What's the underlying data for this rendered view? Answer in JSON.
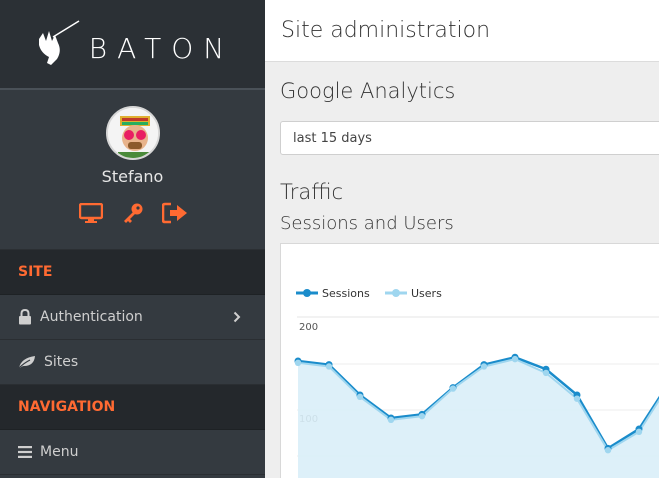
{
  "brand": {
    "name": "BATON"
  },
  "user": {
    "name": "Stefano"
  },
  "profile_actions": [
    {
      "name": "view-site",
      "icon": "monitor-icon"
    },
    {
      "name": "change-password",
      "icon": "key-icon"
    },
    {
      "name": "logout",
      "icon": "sign-out-icon"
    }
  ],
  "sidebar": {
    "site_title": "SITE",
    "site_items": [
      {
        "label": "Authentication",
        "icon": "lock-icon",
        "has_children": true
      },
      {
        "label": "Sites",
        "icon": "leaf-icon",
        "has_children": false
      }
    ],
    "nav_title": "NAVIGATION",
    "nav_items": [
      {
        "label": "Menu",
        "icon": "bars-icon"
      }
    ]
  },
  "header": {
    "title": "Site administration"
  },
  "analytics": {
    "title": "Google Analytics",
    "period_select": {
      "value": "last 15 days"
    }
  },
  "traffic": {
    "title": "Traffic",
    "subtitle": "Sessions and Users"
  },
  "colors": {
    "accent": "#ff6a32",
    "sessions": "#1a8ccb",
    "users": "#9fd6ef",
    "users_fill": "#d9eef8"
  },
  "chart_data": {
    "type": "line",
    "title": "",
    "xlabel": "",
    "ylabel": "",
    "ylim": [
      50,
      200
    ],
    "y_ticks": [
      "200",
      "100"
    ],
    "legend": "top-left",
    "series": [
      {
        "name": "Sessions",
        "values": [
          162,
          158,
          125,
          100,
          104,
          133,
          158,
          166,
          153,
          125,
          67,
          88,
          140
        ]
      },
      {
        "name": "Users",
        "values": [
          160,
          156,
          123,
          98,
          102,
          132,
          156,
          164,
          149,
          121,
          65,
          85,
          138
        ]
      }
    ],
    "x": [
      1,
      2,
      3,
      4,
      5,
      6,
      7,
      8,
      9,
      10,
      11,
      12,
      13
    ]
  }
}
